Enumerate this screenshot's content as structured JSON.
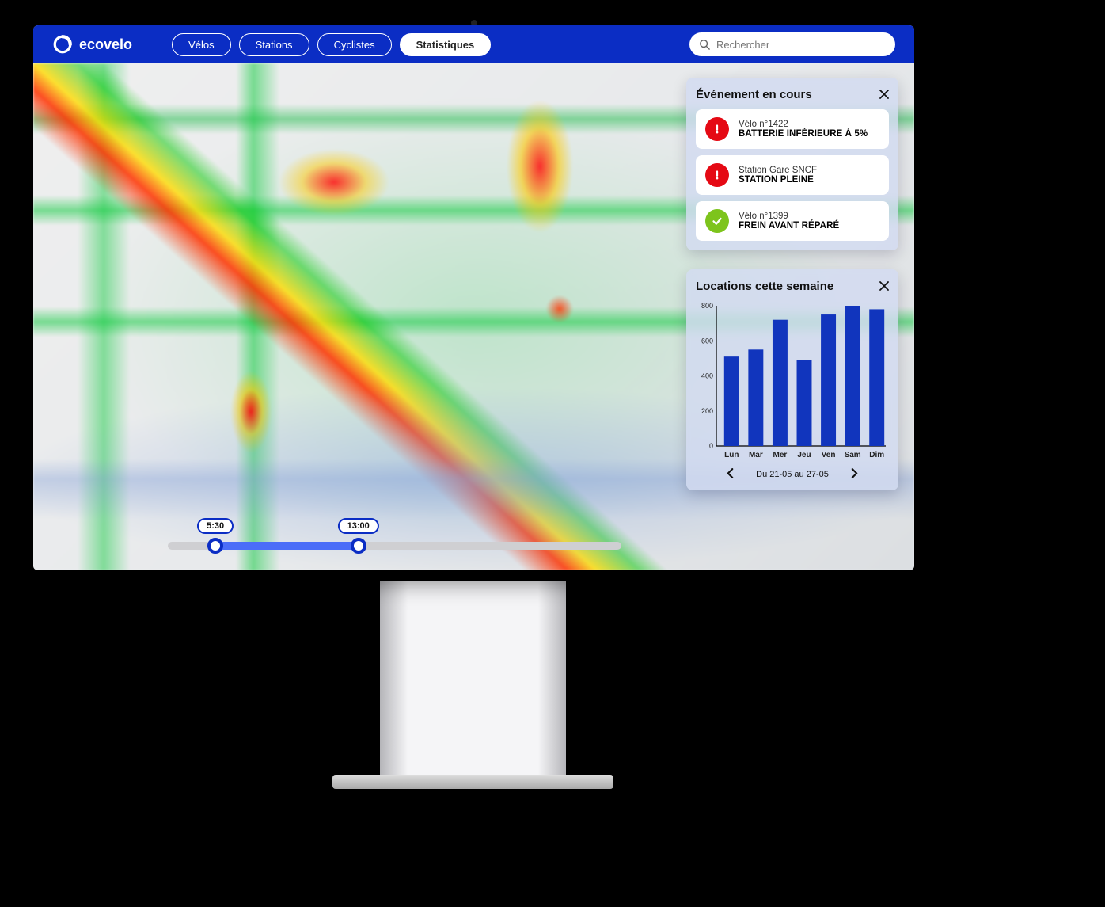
{
  "brand": "ecovelo",
  "nav": {
    "items": [
      "Vélos",
      "Stations",
      "Cyclistes",
      "Statistiques"
    ],
    "activeIndex": 3
  },
  "search": {
    "placeholder": "Rechercher"
  },
  "slider": {
    "start": "5:30",
    "end": "13:00"
  },
  "events": {
    "title": "Événement en cours",
    "items": [
      {
        "icon": "alert-icon",
        "iconKind": "alert",
        "line1": "Vélo n°1422",
        "line2": "BATTERIE INFÉRIEURE À 5%"
      },
      {
        "icon": "alert-icon",
        "iconKind": "alert",
        "line1": "Station Gare SNCF",
        "line2": "STATION PLEINE"
      },
      {
        "icon": "check-icon",
        "iconKind": "ok",
        "line1": "Vélo n°1399",
        "line2": "FREIN AVANT RÉPARÉ"
      }
    ]
  },
  "chart": {
    "title": "Locations cette semaine",
    "range": "Du 21-05 au  27-05"
  },
  "chart_data": {
    "type": "bar",
    "categories": [
      "Lun",
      "Mar",
      "Mer",
      "Jeu",
      "Ven",
      "Sam",
      "Dim"
    ],
    "values": [
      510,
      550,
      720,
      490,
      750,
      800,
      780
    ],
    "title": "Locations cette semaine",
    "xlabel": "",
    "ylabel": "",
    "ylim": [
      0,
      800
    ],
    "yticks": [
      0,
      200,
      400,
      600,
      800
    ]
  },
  "colors": {
    "primary": "#0b2dc4",
    "bar": "#1135bd",
    "alert": "#e50914",
    "ok": "#7dc41c"
  }
}
